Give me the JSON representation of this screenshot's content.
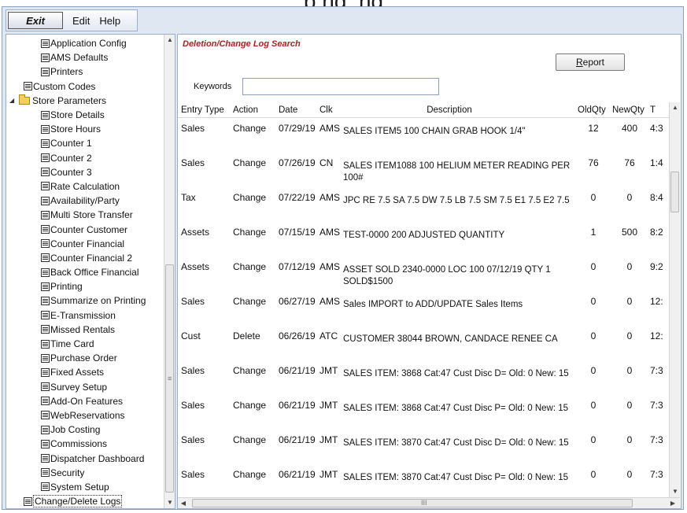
{
  "caption_fragment": "p  ng,   ng",
  "menu": {
    "exit": "Exit",
    "edit": "Edit",
    "help": "Help"
  },
  "tree": {
    "items": [
      {
        "label": "Application Config",
        "level": 2,
        "icon": "document-icon"
      },
      {
        "label": "AMS Defaults",
        "level": 2,
        "icon": "document-icon"
      },
      {
        "label": "Printers",
        "level": 2,
        "icon": "document-icon"
      },
      {
        "label": "Custom Codes",
        "level": 1,
        "icon": "document-icon"
      },
      {
        "label": "Store Parameters",
        "level": 0,
        "icon": "folder-icon",
        "expanded": true
      },
      {
        "label": "Store Details",
        "level": 2,
        "icon": "document-icon"
      },
      {
        "label": "Store Hours",
        "level": 2,
        "icon": "document-icon"
      },
      {
        "label": "Counter 1",
        "level": 2,
        "icon": "document-icon"
      },
      {
        "label": "Counter 2",
        "level": 2,
        "icon": "document-icon"
      },
      {
        "label": "Counter 3",
        "level": 2,
        "icon": "document-icon"
      },
      {
        "label": "Rate Calculation",
        "level": 2,
        "icon": "document-icon"
      },
      {
        "label": "Availability/Party",
        "level": 2,
        "icon": "document-icon"
      },
      {
        "label": "Multi Store Transfer",
        "level": 2,
        "icon": "document-icon"
      },
      {
        "label": "Counter Customer",
        "level": 2,
        "icon": "document-icon"
      },
      {
        "label": "Counter Financial",
        "level": 2,
        "icon": "document-icon"
      },
      {
        "label": "Counter Financial 2",
        "level": 2,
        "icon": "document-icon"
      },
      {
        "label": "Back Office Financial",
        "level": 2,
        "icon": "document-icon"
      },
      {
        "label": "Printing",
        "level": 2,
        "icon": "document-icon"
      },
      {
        "label": "Summarize on Printing",
        "level": 2,
        "icon": "document-icon"
      },
      {
        "label": "E-Transmission",
        "level": 2,
        "icon": "document-icon"
      },
      {
        "label": "Missed Rentals",
        "level": 2,
        "icon": "document-icon"
      },
      {
        "label": "Time Card",
        "level": 2,
        "icon": "document-icon"
      },
      {
        "label": "Purchase Order",
        "level": 2,
        "icon": "document-icon"
      },
      {
        "label": "Fixed Assets",
        "level": 2,
        "icon": "document-icon"
      },
      {
        "label": "Survey Setup",
        "level": 2,
        "icon": "document-icon"
      },
      {
        "label": "Add-On Features",
        "level": 2,
        "icon": "document-icon"
      },
      {
        "label": "WebReservations",
        "level": 2,
        "icon": "document-icon"
      },
      {
        "label": "Job Costing",
        "level": 2,
        "icon": "document-icon"
      },
      {
        "label": "Commissions",
        "level": 2,
        "icon": "document-icon"
      },
      {
        "label": "Dispatcher Dashboard",
        "level": 2,
        "icon": "document-icon"
      },
      {
        "label": "Security",
        "level": 2,
        "icon": "document-icon"
      },
      {
        "label": "System Setup",
        "level": 2,
        "icon": "document-icon"
      },
      {
        "label": "Change/Delete Logs",
        "level": 1,
        "icon": "document-icon",
        "selected": true
      }
    ]
  },
  "search": {
    "title": "Deletion/Change Log Search",
    "report_prefix": "",
    "report_underlined": "R",
    "report_rest": "eport",
    "keywords_label": "Keywords",
    "keywords_value": ""
  },
  "table": {
    "columns": [
      "Entry Type",
      "Action",
      "Date",
      "Clk",
      "Description",
      "OldQty",
      "NewQty",
      "T"
    ],
    "rows": [
      {
        "type": "Sales",
        "action": "Change",
        "date": "07/29/19",
        "clk": "AMS",
        "desc": "SALES ITEM5               100 CHAIN GRAB HOOK 1/4\"",
        "old": "12",
        "new": "400",
        "time": "4:3"
      },
      {
        "type": "Sales",
        "action": "Change",
        "date": "07/26/19",
        "clk": "CN",
        "desc": "SALES ITEM1088          100 HELIUM METER READING PER 100#",
        "old": "76",
        "new": "76",
        "time": "1:4"
      },
      {
        "type": "Tax",
        "action": "Change",
        "date": "07/22/19",
        "clk": "AMS",
        "desc": "JPC     RE 7.5 SA 7.5 DW 7.5 LB 7.5 SM 7.5 E1 7.5 E2 7.5",
        "old": "0",
        "new": "0",
        "time": "8:4"
      },
      {
        "type": "Assets",
        "action": "Change",
        "date": "07/15/19",
        "clk": "AMS",
        "desc": "TEST-0000 200 ADJUSTED QUANTITY",
        "old": "1",
        "new": "500",
        "time": "8:2"
      },
      {
        "type": "Assets",
        "action": "Change",
        "date": "07/12/19",
        "clk": "AMS",
        "desc": "ASSET SOLD 2340-0000 LOC 100 07/12/19 QTY 1 SOLD$1500",
        "old": "0",
        "new": "0",
        "time": "9:2"
      },
      {
        "type": "Sales",
        "action": "Change",
        "date": "06/27/19",
        "clk": "AMS",
        "desc": "Sales IMPORT to ADD/UPDATE Sales Items",
        "old": "0",
        "new": "0",
        "time": "12:"
      },
      {
        "type": "Cust",
        "action": "Delete",
        "date": "06/26/19",
        "clk": "ATC",
        "desc": "CUSTOMER 38044 BROWN, CANDACE RENEE CA",
        "old": "0",
        "new": "0",
        "time": "12:"
      },
      {
        "type": "Sales",
        "action": "Change",
        "date": "06/21/19",
        "clk": "JMT",
        "desc": "SALES ITEM: 3868 Cat:47 Cust Disc D= Old: 0 New: 15",
        "old": "0",
        "new": "0",
        "time": "7:3"
      },
      {
        "type": "Sales",
        "action": "Change",
        "date": "06/21/19",
        "clk": "JMT",
        "desc": "SALES ITEM: 3868 Cat:47 Cust Disc P= Old: 0 New: 15",
        "old": "0",
        "new": "0",
        "time": "7:3"
      },
      {
        "type": "Sales",
        "action": "Change",
        "date": "06/21/19",
        "clk": "JMT",
        "desc": "SALES ITEM: 3870 Cat:47 Cust Disc D= Old: 0 New: 15",
        "old": "0",
        "new": "0",
        "time": "7:3"
      },
      {
        "type": "Sales",
        "action": "Change",
        "date": "06/21/19",
        "clk": "JMT",
        "desc": "SALES ITEM: 3870 Cat:47 Cust Disc P= Old: 0 New: 15",
        "old": "0",
        "new": "0",
        "time": "7:3"
      }
    ]
  },
  "scroll_grip": "≡",
  "hscroll_grip": "III",
  "colors": {
    "title_red": "#b02020",
    "frame_blue": "#9aaec6"
  }
}
